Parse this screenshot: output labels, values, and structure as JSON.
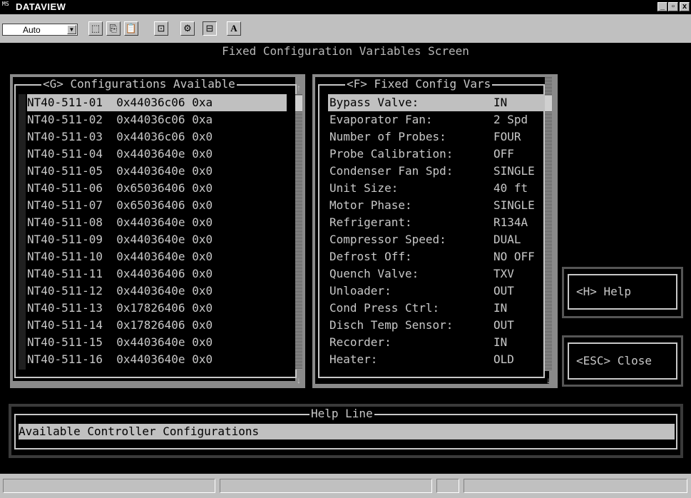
{
  "window": {
    "icon": "MS",
    "title": "DATAVIEW",
    "controls": {
      "minimize": "_",
      "restore": "▫",
      "close": "x"
    }
  },
  "toolbar": {
    "font_combo": {
      "value": "Auto",
      "arrow": "▼"
    },
    "buttons": [
      {
        "icon": "select-icon",
        "glyph": "⬚"
      },
      {
        "icon": "copy-icon",
        "glyph": "⎘"
      },
      {
        "icon": "paste-icon",
        "glyph": "📋"
      },
      {
        "icon": "fullscreen-icon",
        "glyph": "⊡"
      },
      {
        "icon": "properties-icon",
        "glyph": "⚙"
      },
      {
        "icon": "background-icon",
        "glyph": "⊟"
      },
      {
        "icon": "font-icon",
        "glyph": "A"
      }
    ]
  },
  "screen": {
    "title": "Fixed Configuration Variables Screen",
    "configurations": {
      "header": "<G> Configurations Available",
      "items": [
        "NT40-511-01  0x44036c06 0xa",
        "NT40-511-02  0x44036c06 0xa",
        "NT40-511-03  0x44036c06 0x0",
        "NT40-511-04  0x4403640e 0x0",
        "NT40-511-05  0x4403640e 0x0",
        "NT40-511-06  0x65036406 0x0",
        "NT40-511-07  0x65036406 0x0",
        "NT40-511-08  0x4403640e 0x0",
        "NT40-511-09  0x4403640e 0x0",
        "NT40-511-10  0x4403640e 0x0",
        "NT40-511-11  0x44036406 0x0",
        "NT40-511-12  0x4403640e 0x0",
        "NT40-511-13  0x17826406 0x0",
        "NT40-511-14  0x17826406 0x0",
        "NT40-511-15  0x4403640e 0x0",
        "NT40-511-16  0x4403640e 0x0"
      ],
      "selected_index": 0,
      "scroll_up": "↑",
      "scroll_down": "↓"
    },
    "fixed_vars": {
      "header": "<F> Fixed Config Vars",
      "items": [
        {
          "label": "Bypass Valve:",
          "value": "IN"
        },
        {
          "label": "Evaporator Fan:",
          "value": "2 Spd"
        },
        {
          "label": "Number of Probes:",
          "value": "FOUR"
        },
        {
          "label": "Probe Calibration:",
          "value": "OFF"
        },
        {
          "label": "Condenser Fan Spd:",
          "value": "SINGLE"
        },
        {
          "label": "Unit Size:",
          "value": "40 ft"
        },
        {
          "label": "Motor Phase:",
          "value": "SINGLE"
        },
        {
          "label": "Refrigerant:",
          "value": "R134A"
        },
        {
          "label": "Compressor Speed:",
          "value": "DUAL"
        },
        {
          "label": "Defrost Off:",
          "value": "NO OFF"
        },
        {
          "label": "Quench Valve:",
          "value": "TXV"
        },
        {
          "label": "Unloader:",
          "value": "OUT"
        },
        {
          "label": "Cond Press Ctrl:",
          "value": "IN"
        },
        {
          "label": "Disch Temp Sensor:",
          "value": "OUT"
        },
        {
          "label": "Recorder:",
          "value": "IN"
        },
        {
          "label": "Heater:",
          "value": "OLD"
        }
      ],
      "selected_index": 0,
      "scroll_down": "↓"
    },
    "help_button": "<H> Help",
    "close_button": "<ESC> Close",
    "help_line": {
      "header": "Help Line",
      "text": "Available Controller Configurations"
    }
  }
}
